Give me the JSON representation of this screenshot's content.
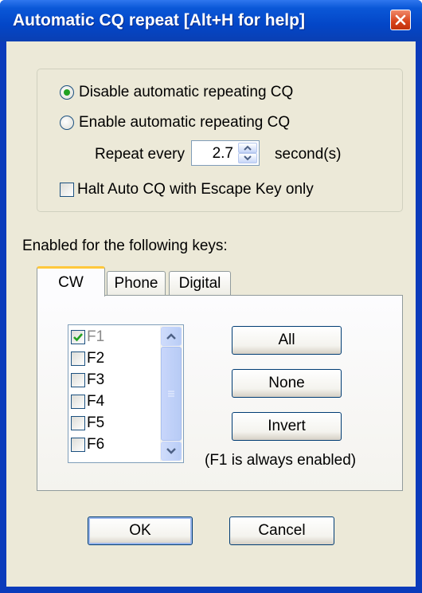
{
  "window": {
    "title": "Automatic CQ repeat [Alt+H for help]"
  },
  "repeat_group": {
    "disable_label": "Disable automatic repeating CQ",
    "enable_label": "Enable automatic repeating CQ",
    "selected": "disable",
    "repeat_every_label": "Repeat every",
    "repeat_value": "2.7",
    "seconds_label": "second(s)",
    "halt_label": "Halt Auto CQ with Escape Key only",
    "halt_checked": false
  },
  "keys_label": "Enabled for the following keys:",
  "tabs": [
    {
      "label": "CW",
      "active": true
    },
    {
      "label": "Phone",
      "active": false
    },
    {
      "label": "Digital",
      "active": false
    }
  ],
  "keys": [
    {
      "label": "F1",
      "checked": true,
      "disabled": true
    },
    {
      "label": "F2",
      "checked": false
    },
    {
      "label": "F3",
      "checked": false
    },
    {
      "label": "F4",
      "checked": false
    },
    {
      "label": "F5",
      "checked": false
    },
    {
      "label": "F6",
      "checked": false
    }
  ],
  "buttons": {
    "all": "All",
    "none": "None",
    "invert": "Invert",
    "ok": "OK",
    "cancel": "Cancel"
  },
  "note": "(F1 is always enabled)",
  "colors": {
    "titlebar": "#0346c7",
    "dialog_bg": "#ece9d8",
    "radio_selected": "#21a121",
    "check_mark": "#21a121",
    "tab_accent": "#ffc83c"
  },
  "icons": {
    "close": "close-icon",
    "spin_up": "chevron-up-icon",
    "spin_down": "chevron-down-icon",
    "scroll_up": "chevron-up-icon",
    "scroll_down": "chevron-down-icon",
    "check": "checkmark-icon"
  }
}
